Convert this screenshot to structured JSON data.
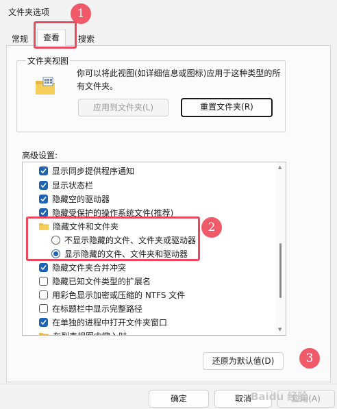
{
  "window": {
    "title": "文件夹选项"
  },
  "tabs": [
    {
      "label": "常规"
    },
    {
      "label": "查看"
    },
    {
      "label": "搜索"
    }
  ],
  "folder_views": {
    "group_label": "文件夹视图",
    "description": "你可以将此视图(如详细信息或图标)应用于这种类型的所有文件夹。",
    "apply_button": "应用到文件夹(L)",
    "reset_button": "重置文件夹(R)"
  },
  "advanced": {
    "label": "高级设置:",
    "items": [
      {
        "type": "checkbox",
        "checked": true,
        "label": "显示同步提供程序通知"
      },
      {
        "type": "checkbox",
        "checked": true,
        "label": "显示状态栏"
      },
      {
        "type": "checkbox",
        "checked": true,
        "label": "隐藏空的驱动器"
      },
      {
        "type": "checkbox",
        "checked": true,
        "label": "隐藏受保护的操作系统文件(推荐)"
      },
      {
        "type": "folder",
        "label": "隐藏文件和文件夹"
      },
      {
        "type": "radio",
        "checked": false,
        "label": "不显示隐藏的文件、文件夹或驱动器"
      },
      {
        "type": "radio",
        "checked": true,
        "label": "显示隐藏的文件、文件夹和驱动器"
      },
      {
        "type": "checkbox",
        "checked": true,
        "label": "隐藏文件夹合并冲突"
      },
      {
        "type": "checkbox",
        "checked": false,
        "label": "隐藏已知文件类型的扩展名"
      },
      {
        "type": "checkbox",
        "checked": false,
        "label": "用彩色显示加密或压缩的 NTFS 文件"
      },
      {
        "type": "checkbox",
        "checked": false,
        "label": "在标题栏中显示完整路径"
      },
      {
        "type": "checkbox",
        "checked": true,
        "label": "在单独的进程中打开文件夹窗口"
      },
      {
        "type": "folder",
        "label": "在列表视图中键入时"
      }
    ],
    "restore_button": "还原为默认值(D)"
  },
  "footer": {
    "ok": "确定",
    "cancel": "取消",
    "apply": "应用(A)"
  },
  "annotations": {
    "badge1": "1",
    "badge2": "2",
    "badge3": "3"
  },
  "watermark": "Baidu 经验",
  "colors": {
    "accent": "#1e63b3",
    "annotation": "#e8495f",
    "badge": "#ef5968"
  }
}
